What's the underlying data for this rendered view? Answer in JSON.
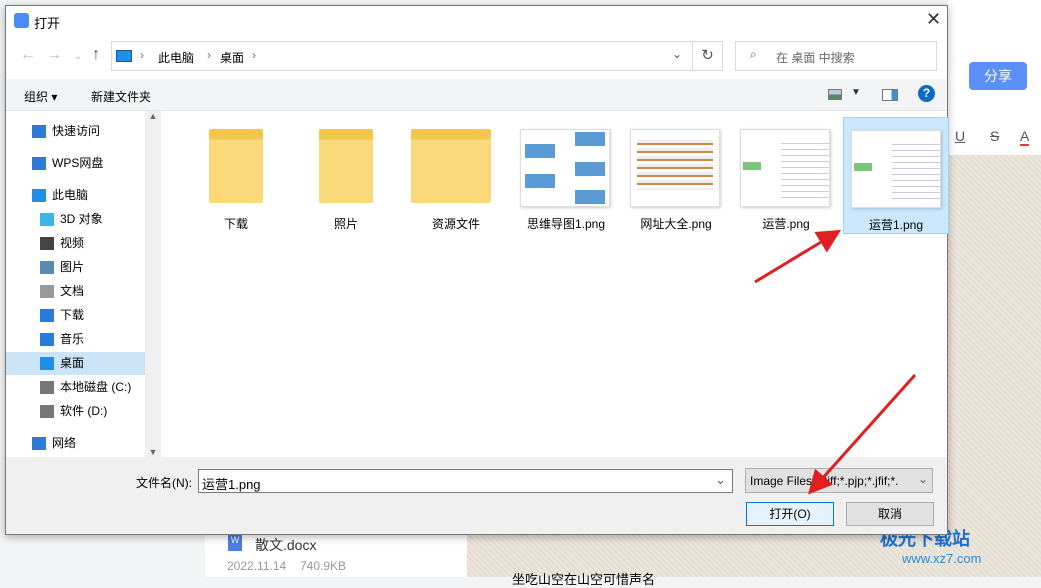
{
  "background": {
    "share_label": "分享",
    "format_icons": [
      "underline-icon",
      "strikethrough-icon",
      "font-color-icon"
    ],
    "fmt_u": "U",
    "fmt_s": "S",
    "fmt_a": "A",
    "recent_file": {
      "name": "散文.docx",
      "date": "2022.11.14",
      "size": "740.9KB"
    },
    "doc_text": "坐吃山空在山空可惜声名"
  },
  "dialog": {
    "title": "打开",
    "breadcrumb": [
      "此电脑",
      "桌面"
    ],
    "search_placeholder": "在 桌面 中搜索",
    "toolbar": {
      "organize": "组织",
      "new_folder": "新建文件夹"
    },
    "sidebar": [
      {
        "label": "快速访问",
        "icon": "star-icon"
      },
      {
        "label": "WPS网盘",
        "icon": "cloud-icon"
      },
      {
        "label": "此电脑",
        "icon": "computer-icon"
      },
      {
        "label": "3D 对象",
        "icon": "cube-icon"
      },
      {
        "label": "视频",
        "icon": "video-icon"
      },
      {
        "label": "图片",
        "icon": "picture-icon"
      },
      {
        "label": "文档",
        "icon": "document-icon"
      },
      {
        "label": "下载",
        "icon": "download-icon"
      },
      {
        "label": "音乐",
        "icon": "music-icon"
      },
      {
        "label": "桌面",
        "icon": "desktop-icon",
        "selected": true
      },
      {
        "label": "本地磁盘 (C:)",
        "icon": "drive-icon"
      },
      {
        "label": "软件 (D:)",
        "icon": "drive-icon"
      },
      {
        "label": "网络",
        "icon": "network-icon"
      }
    ],
    "files": [
      {
        "name": "下载",
        "type": "folder"
      },
      {
        "name": "照片",
        "type": "folder"
      },
      {
        "name": "资源文件",
        "type": "folder"
      },
      {
        "name": "思维导图1.png",
        "type": "image"
      },
      {
        "name": "网址大全.png",
        "type": "image"
      },
      {
        "name": "运营.png",
        "type": "image"
      },
      {
        "name": "运营1.png",
        "type": "image",
        "selected": true
      }
    ],
    "filename_label": "文件名(N):",
    "filename_value": "运营1.png",
    "filetype": "Image Files(*.tiff;*.pjp;*.jfif;*.",
    "open_label": "打开(O)",
    "cancel_label": "取消"
  },
  "watermark": {
    "text": "极光下载站",
    "url": "www.xz7.com"
  },
  "colors": {
    "accent": "#0078d7",
    "selection": "#cce8ff",
    "arrow": "#e02020",
    "share": "#5b8ff9"
  }
}
